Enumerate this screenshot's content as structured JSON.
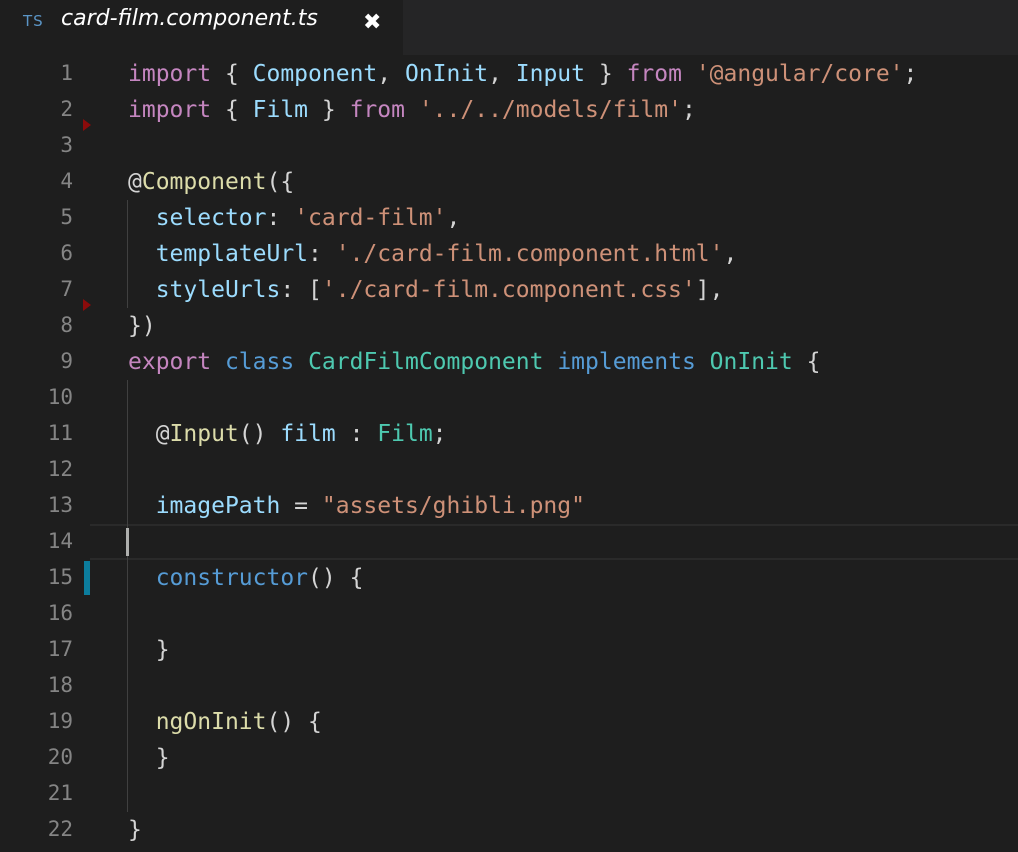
{
  "tab": {
    "language_badge": "TS",
    "filename": "card-film.component.ts",
    "close_glyph": "✖"
  },
  "editor": {
    "cursor_line": 14,
    "lines": [
      {
        "n": "1",
        "tokens": [
          [
            "k",
            "import"
          ],
          [
            "p",
            " { "
          ],
          [
            "v",
            "Component"
          ],
          [
            "p",
            ", "
          ],
          [
            "v",
            "OnInit"
          ],
          [
            "p",
            ", "
          ],
          [
            "v",
            "Input"
          ],
          [
            "p",
            " } "
          ],
          [
            "k",
            "from"
          ],
          [
            "p",
            " "
          ],
          [
            "s",
            "'@angular/core'"
          ],
          [
            "p",
            ";"
          ]
        ]
      },
      {
        "n": "2",
        "tokens": [
          [
            "k",
            "import"
          ],
          [
            "p",
            " { "
          ],
          [
            "v",
            "Film"
          ],
          [
            "p",
            " } "
          ],
          [
            "k",
            "from"
          ],
          [
            "p",
            " "
          ],
          [
            "s",
            "'../../models/film'"
          ],
          [
            "p",
            ";"
          ]
        ]
      },
      {
        "n": "3",
        "tokens": []
      },
      {
        "n": "4",
        "tokens": [
          [
            "p",
            "@"
          ],
          [
            "f",
            "Component"
          ],
          [
            "p",
            "({"
          ]
        ]
      },
      {
        "n": "5",
        "tokens": [
          [
            "p",
            "  "
          ],
          [
            "v",
            "selector"
          ],
          [
            "p",
            ": "
          ],
          [
            "s",
            "'card-film'"
          ],
          [
            "p",
            ","
          ]
        ]
      },
      {
        "n": "6",
        "tokens": [
          [
            "p",
            "  "
          ],
          [
            "v",
            "templateUrl"
          ],
          [
            "p",
            ": "
          ],
          [
            "s",
            "'./card-film.component.html'"
          ],
          [
            "p",
            ","
          ]
        ]
      },
      {
        "n": "7",
        "tokens": [
          [
            "p",
            "  "
          ],
          [
            "v",
            "styleUrls"
          ],
          [
            "p",
            ": ["
          ],
          [
            "s",
            "'./card-film.component.css'"
          ],
          [
            "p",
            "],"
          ]
        ]
      },
      {
        "n": "8",
        "tokens": [
          [
            "p",
            "})"
          ]
        ]
      },
      {
        "n": "9",
        "tokens": [
          [
            "k",
            "export"
          ],
          [
            "p",
            " "
          ],
          [
            "kb",
            "class"
          ],
          [
            "p",
            " "
          ],
          [
            "t",
            "CardFilmComponent"
          ],
          [
            "p",
            " "
          ],
          [
            "kb",
            "implements"
          ],
          [
            "p",
            " "
          ],
          [
            "t",
            "OnInit"
          ],
          [
            "p",
            " {"
          ]
        ]
      },
      {
        "n": "10",
        "tokens": []
      },
      {
        "n": "11",
        "tokens": [
          [
            "p",
            "  @"
          ],
          [
            "f",
            "Input"
          ],
          [
            "p",
            "() "
          ],
          [
            "v",
            "film"
          ],
          [
            "p",
            " : "
          ],
          [
            "t",
            "Film"
          ],
          [
            "p",
            ";"
          ]
        ]
      },
      {
        "n": "12",
        "tokens": []
      },
      {
        "n": "13",
        "tokens": [
          [
            "p",
            "  "
          ],
          [
            "v",
            "imagePath"
          ],
          [
            "p",
            " = "
          ],
          [
            "s",
            "\"assets/ghibli.png\""
          ]
        ]
      },
      {
        "n": "14",
        "tokens": []
      },
      {
        "n": "15",
        "tokens": [
          [
            "p",
            "  "
          ],
          [
            "kb",
            "constructor"
          ],
          [
            "p",
            "() {"
          ]
        ]
      },
      {
        "n": "16",
        "tokens": []
      },
      {
        "n": "17",
        "tokens": [
          [
            "p",
            "  }"
          ]
        ]
      },
      {
        "n": "18",
        "tokens": []
      },
      {
        "n": "19",
        "tokens": [
          [
            "p",
            "  "
          ],
          [
            "f",
            "ngOnInit"
          ],
          [
            "p",
            "() {"
          ]
        ]
      },
      {
        "n": "20",
        "tokens": [
          [
            "p",
            "  }"
          ]
        ]
      },
      {
        "n": "21",
        "tokens": []
      },
      {
        "n": "22",
        "tokens": [
          [
            "p",
            "}"
          ]
        ]
      }
    ]
  },
  "colors": {
    "background": "#1e1e1e",
    "keyword_control": "#c586c0",
    "keyword": "#569cd6",
    "variable": "#9cdcfe",
    "string": "#ce9178",
    "type": "#4ec9b0",
    "function": "#dcdcaa",
    "line_number": "#858585"
  }
}
